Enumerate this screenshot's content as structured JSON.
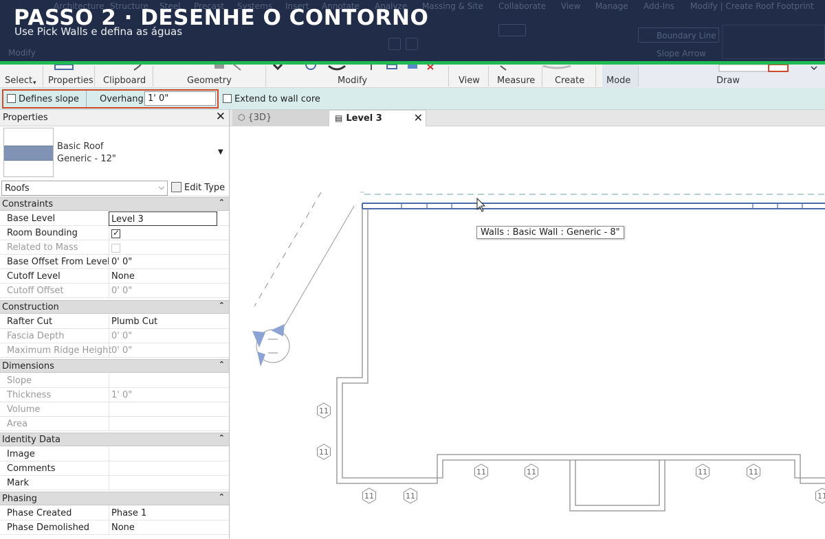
{
  "banner": {
    "title": "PASSO 2 · DESENHE O CONTORNO",
    "subtitle": "Use Pick Walls e defina as águas"
  },
  "ribbon": {
    "groups": [
      "Select",
      "Properties",
      "Clipboard",
      "Geometry",
      "Modify",
      "View",
      "Measure",
      "Create",
      "Mode",
      "Draw"
    ]
  },
  "options_bar": {
    "defines_slope_label": "Defines slope",
    "defines_slope_checked": false,
    "overhang_label": "Overhang:",
    "overhang_value": "1'  0\"",
    "extend_label": "Extend to wall core",
    "extend_checked": false,
    "highlight_color": "#d1492b"
  },
  "properties": {
    "title": "Properties",
    "type_name": "Basic Roof",
    "type_sub": "Generic - 12\"",
    "category": "Roofs",
    "edit_type": "Edit Type",
    "groups": {
      "constraints": "Constraints",
      "construction": "Construction",
      "dimensions": "Dimensions",
      "identity": "Identity Data",
      "phasing": "Phasing"
    },
    "rows": {
      "base_level": {
        "name": "Base Level",
        "value": "Level 3"
      },
      "room_bounding": {
        "name": "Room Bounding",
        "checked": true
      },
      "related_mass": {
        "name": "Related to Mass",
        "checked": false
      },
      "base_offset": {
        "name": "Base Offset From Level",
        "value": "0'  0\""
      },
      "cutoff_level": {
        "name": "Cutoff Level",
        "value": "None"
      },
      "cutoff_offset": {
        "name": "Cutoff Offset",
        "value": "0'  0\""
      },
      "rafter_cut": {
        "name": "Rafter Cut",
        "value": "Plumb Cut"
      },
      "fascia_depth": {
        "name": "Fascia Depth",
        "value": "0'  0\""
      },
      "max_ridge": {
        "name": "Maximum Ridge Height",
        "value": "0'  0\""
      },
      "slope": {
        "name": "Slope",
        "value": ""
      },
      "thickness": {
        "name": "Thickness",
        "value": "1'  0\""
      },
      "volume": {
        "name": "Volume",
        "value": ""
      },
      "area": {
        "name": "Area",
        "value": ""
      },
      "image": {
        "name": "Image",
        "value": ""
      },
      "comments": {
        "name": "Comments",
        "value": ""
      },
      "mark": {
        "name": "Mark",
        "value": ""
      },
      "phase_created": {
        "name": "Phase Created",
        "value": "Phase 1"
      },
      "phase_demolished": {
        "name": "Phase Demolished",
        "value": "None"
      }
    }
  },
  "view": {
    "tabs": {
      "tab_3d": "{3D}",
      "tab_level3": "Level 3"
    },
    "tooltip": "Walls : Basic Wall : Generic - 8\"",
    "tag_label": "11",
    "colors": {
      "wall": "#8d8d8d",
      "selected_wall": "#4a6aa8",
      "dashed": "#9cc4c4"
    }
  }
}
